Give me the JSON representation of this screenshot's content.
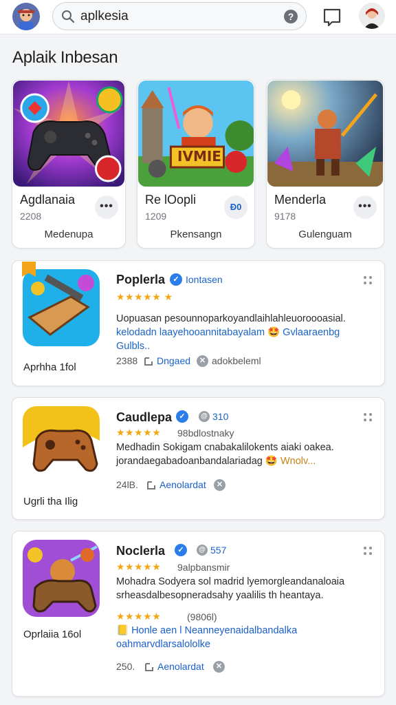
{
  "header": {
    "search_value": "aplkesia",
    "help_glyph": "?"
  },
  "section": {
    "title": "Aplaik Inbesan"
  },
  "featured": [
    {
      "name": "Agdlanaia",
      "number": "2208",
      "category": "Medenupa",
      "more": "•••"
    },
    {
      "name": "Re lOopli",
      "number": "1209",
      "category": "Pkensangn",
      "more": "Đ0"
    },
    {
      "name": "Menderla",
      "number": "9178",
      "category": "Gulenguam",
      "more": "•••"
    }
  ],
  "featured_art": {
    "banner_text": "IVMIE"
  },
  "list": [
    {
      "title": "Poplerla",
      "after_title": "Iontasen",
      "stars": "★★★★★ ★",
      "description": "Uopuasan pesounnoparkoyandlaihlahleuoroooasial. ",
      "description_hl": "kelodadn  laayehooannitabayalam 🤩 Gvlaaraenbg Gulbls..",
      "caption": "Aprhha 1fol",
      "meta_count": "2388",
      "meta_link": "Dngaed",
      "meta_tail": "adokbeleml"
    },
    {
      "title": "Caudlepa",
      "after_title": "310",
      "stars": "★★★★★",
      "subtitle": "98bdlostnaky",
      "description": "Medhadin Sokigam cnabakalilokents aiaki oakea. jorandaegabadoanbandalariadag ",
      "description_hl": "🤩 Wnolv...",
      "caption": "Ugrli tha Ilig",
      "meta_count": "24lB.",
      "meta_link": "Aenolardat",
      "meta_tail": ""
    },
    {
      "title": "Noclerla",
      "after_title": "557",
      "stars": "★★★★★",
      "subtitle": "9alpbansmir",
      "description": "Mohadra Sodyera sol madrid lyemorgleandanaloaia srheasdalbesopneradsahy yaalilis th heantaya.",
      "stars2": "★★★★★",
      "stars2_text": "(9806l)",
      "links": "📒 Honle aen l Neanneyenaidalbandalka oahmarvdlarsalololke",
      "caption": "Oprlaiia 16ol",
      "meta_count": "250.",
      "meta_link": "Aenolardat",
      "meta_tail": ""
    }
  ]
}
